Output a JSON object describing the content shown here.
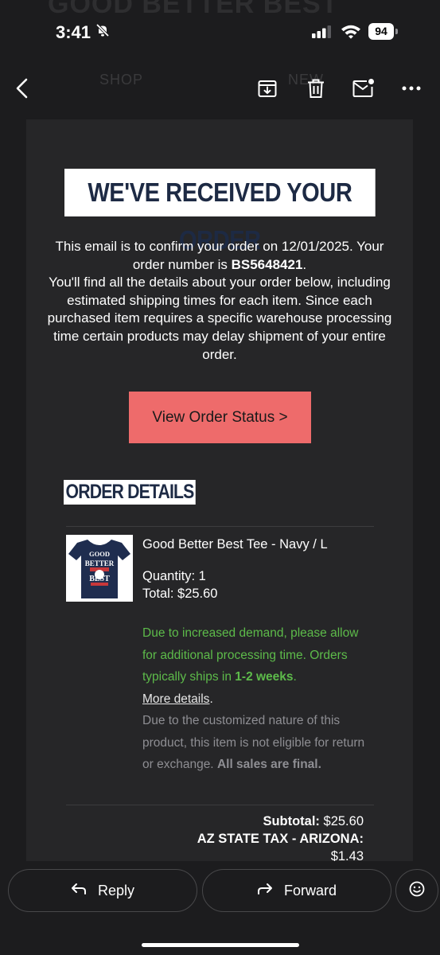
{
  "status_bar": {
    "time": "3:41",
    "battery": "94",
    "ghost_text": "GOOD BETTER BEST"
  },
  "toolbar": {
    "ghost_left": "SHOP",
    "ghost_right": "NEW",
    "icons": [
      "back-icon",
      "archive-icon",
      "trash-icon",
      "mark-unread-icon",
      "more-icon"
    ]
  },
  "email": {
    "hero_title": "WE'VE RECEIVED YOUR ORDER",
    "intro_part1": "This email is to confirm your order on 12/01/2025. Your order number is ",
    "order_number": "BS5648421",
    "intro_part2": ".",
    "intro_part3": "You'll find all the details about your order below, including estimated shipping times for each item. Since each purchased item requires a specific warehouse processing time certain products may delay shipment of your entire order.",
    "cta_label": "View Order Status >",
    "section_title": "ORDER DETAILS",
    "item": {
      "name": "Good Better Best Tee - Navy / L",
      "quantity": "Quantity: 1",
      "total": "Total: $25.60",
      "thumb_text": [
        "GOOD",
        "BETTER",
        "BEST"
      ]
    },
    "notice_green_part1": "Due to increased demand, please allow for additional processing time. Orders typically ships in ",
    "notice_green_bold": "1-2 weeks",
    "notice_green_part2": ".",
    "more_details": "More details",
    "more_details_suffix": ".",
    "notice_grey_part1": "Due to the customized nature of this product, this item is not eligible for return or exchange. ",
    "notice_grey_bold": "All sales are final.",
    "subtotal_label": "Subtotal:",
    "subtotal_value": "$25.60",
    "tax_label": "AZ STATE TAX - ARIZONA:",
    "tax_value": "$1.43"
  },
  "reply_bar": {
    "reply_label": "Reply",
    "forward_label": "Forward"
  },
  "colors": {
    "cta": "#ee6b6b",
    "banner_text": "#1d2a44",
    "green_notice": "#5dbb4a",
    "background": "#1c1c1e"
  }
}
